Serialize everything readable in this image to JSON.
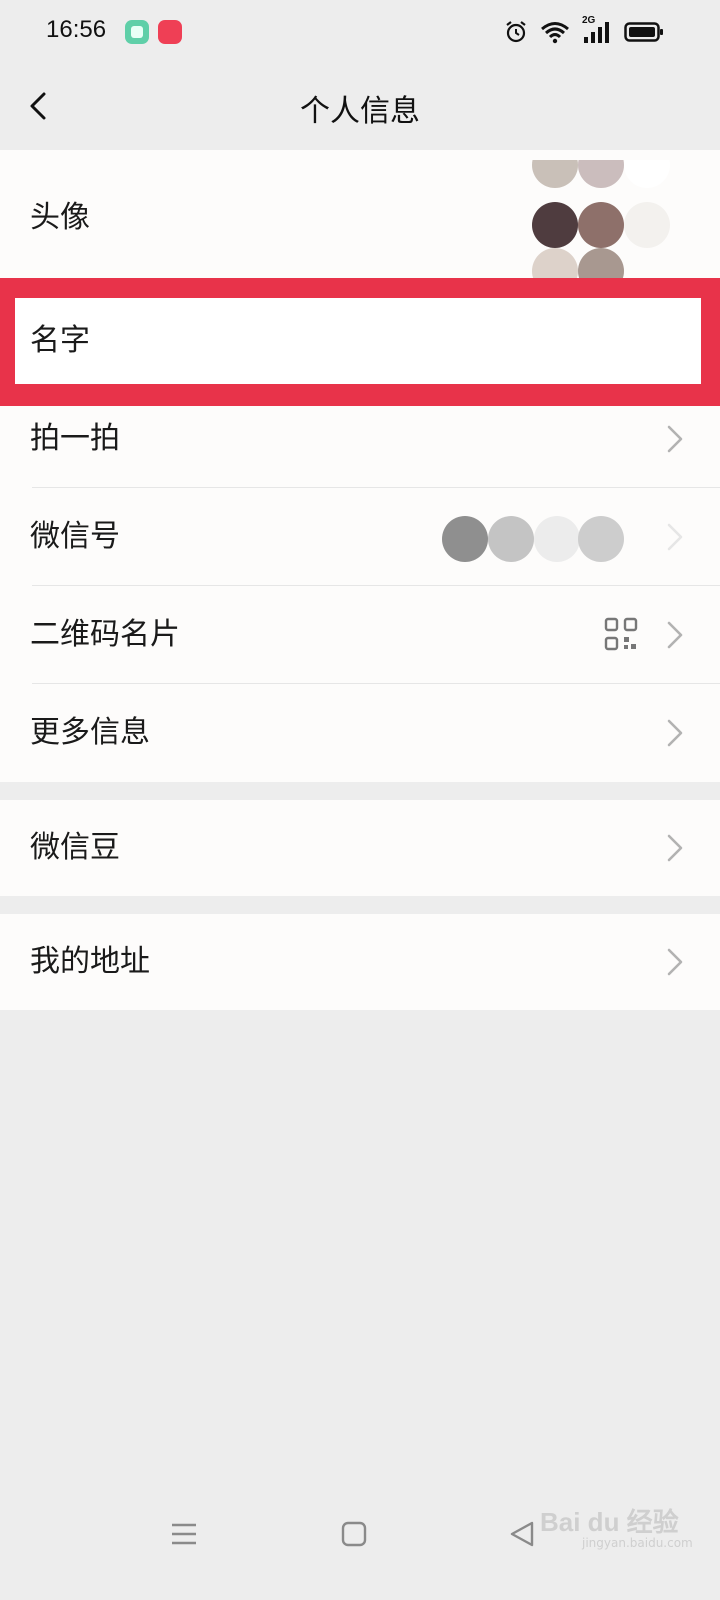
{
  "status_bar": {
    "time": "16:56",
    "network_label": "2G",
    "icons": [
      "app-icon-green",
      "app-icon-xiaohongshu",
      "alarm-icon",
      "wifi-icon",
      "signal-icon",
      "battery-icon"
    ]
  },
  "nav": {
    "title": "个人信息",
    "back_icon": "chevron-left-icon"
  },
  "profile_group": {
    "items": [
      {
        "label": "头像"
      },
      {
        "label": "名字"
      },
      {
        "label": "拍一拍"
      },
      {
        "label": "微信号"
      },
      {
        "label": "二维码名片"
      },
      {
        "label": "更多信息"
      }
    ]
  },
  "beans_group": {
    "label": "微信豆"
  },
  "address_group": {
    "label": "我的地址"
  },
  "highlight": {
    "color": "#e8334a",
    "target": "名字"
  },
  "watermark": {
    "brand": "Bai du 经验",
    "url": "jingyan.baidu.com"
  },
  "colors": {
    "background": "#ededed",
    "cell": "#fdfcfb",
    "text": "#1a1a1a",
    "chevron": "#b2b2b2"
  }
}
